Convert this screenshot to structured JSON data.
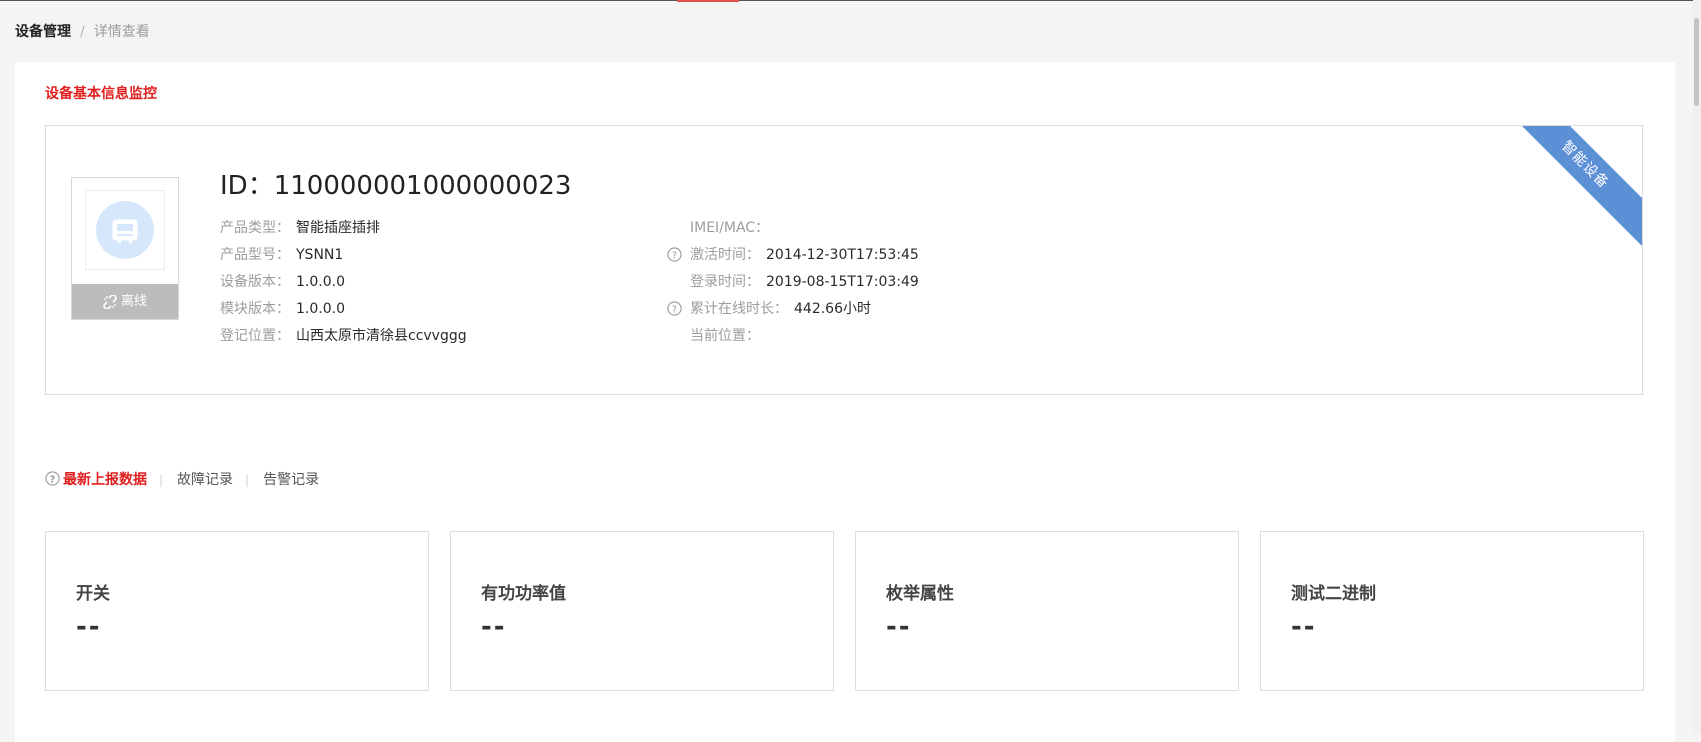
{
  "breadcrumb": {
    "home": "设备管理",
    "separator": "/",
    "current": "详情查看"
  },
  "section_title": "设备基本信息监控",
  "ribbon": "智能设备",
  "device": {
    "status": "离线",
    "id_label": "ID：",
    "id": "110000001000000023",
    "left_fields": [
      {
        "label": "产品类型：",
        "value": "智能插座插排"
      },
      {
        "label": "产品型号：",
        "value": "YSNN1"
      },
      {
        "label": "设备版本：",
        "value": "1.0.0.0"
      },
      {
        "label": "模块版本：",
        "value": "1.0.0.0"
      },
      {
        "label": "登记位置：",
        "value": "山西太原市清徐县ccvvggg"
      }
    ],
    "right_fields": [
      {
        "label": "IMEI/MAC：",
        "value": ""
      },
      {
        "label": "激活时间：",
        "value": "2014-12-30T17:53:45"
      },
      {
        "label": "登录时间：",
        "value": "2019-08-15T17:03:49"
      },
      {
        "label": "累计在线时长：",
        "value": "442.66小时"
      },
      {
        "label": "当前位置：",
        "value": ""
      }
    ]
  },
  "tabs": [
    {
      "label": "最新上报数据"
    },
    {
      "label": "故障记录"
    },
    {
      "label": "告警记录"
    }
  ],
  "metrics": [
    {
      "title": "开关",
      "value": "--"
    },
    {
      "title": "有功功率值",
      "value": "--"
    },
    {
      "title": "枚举属性",
      "value": "--"
    },
    {
      "title": "测试二进制",
      "value": "--"
    }
  ],
  "colors": {
    "accent_red": "#e02020",
    "ribbon_blue": "#5b8fd6",
    "offline_gray": "#bcbcbc"
  },
  "icons": [
    "device-icon",
    "unlink-icon",
    "help-icon"
  ]
}
